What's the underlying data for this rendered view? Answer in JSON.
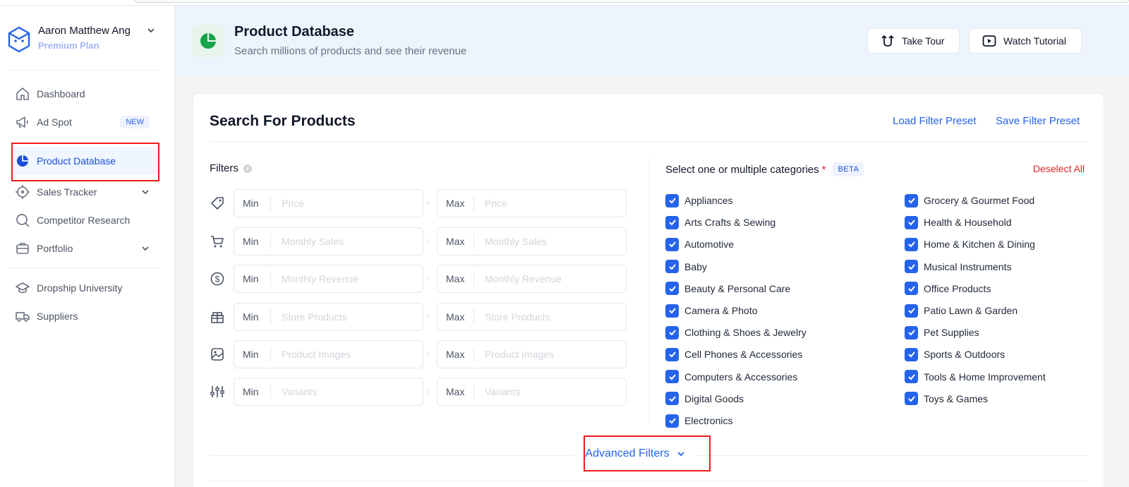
{
  "user": {
    "name": "Aaron Matthew Ang",
    "plan": "Premium Plan"
  },
  "sidebar": {
    "items": [
      {
        "label": "Dashboard",
        "icon": "home-icon"
      },
      {
        "label": "Ad Spot",
        "icon": "megaphone-icon",
        "badge": "NEW"
      },
      {
        "label": "Product Database",
        "icon": "pie-chart-icon",
        "active": true
      },
      {
        "label": "Sales Tracker",
        "icon": "crosshair-icon"
      },
      {
        "label": "Competitor Research",
        "icon": "search-icon"
      },
      {
        "label": "Portfolio",
        "icon": "briefcase-icon"
      },
      {
        "label": "Dropship University",
        "icon": "graduation-cap-icon"
      },
      {
        "label": "Suppliers",
        "icon": "truck-icon"
      }
    ]
  },
  "header": {
    "title": "Product Database",
    "subtitle": "Search millions of products and see their revenue",
    "take_tour": "Take Tour",
    "watch_tutorial": "Watch Tutorial"
  },
  "search": {
    "title": "Search For Products",
    "load_preset": "Load Filter Preset",
    "save_preset": "Save Filter Preset",
    "filters_label": "Filters",
    "min_label": "Min",
    "max_label": "Max",
    "filters": [
      {
        "placeholder": "Price",
        "icon": "tag-icon"
      },
      {
        "placeholder": "Monthly Sales",
        "icon": "cart-icon"
      },
      {
        "placeholder": "Monthly Revenue",
        "icon": "dollar-icon"
      },
      {
        "placeholder": "Store Products",
        "icon": "gift-icon"
      },
      {
        "placeholder": "Product Images",
        "icon": "image-icon"
      },
      {
        "placeholder": "Variants",
        "icon": "sliders-icon"
      }
    ],
    "categories_label": "Select one or multiple categories",
    "required_mark": "*",
    "beta": "BETA",
    "deselect_all": "Deselect All",
    "categories_left": [
      "Appliances",
      "Arts Crafts & Sewing",
      "Automotive",
      "Baby",
      "Beauty & Personal Care",
      "Camera & Photo",
      "Clothing & Shoes & Jewelry",
      "Cell Phones & Accessories",
      "Computers & Accessories",
      "Digital Goods",
      "Electronics"
    ],
    "categories_right": [
      "Grocery & Gourmet Food",
      "Health & Household",
      "Home & Kitchen & Dining",
      "Musical Instruments",
      "Office Products",
      "Patio Lawn & Garden",
      "Pet Supplies",
      "Sports & Outdoors",
      "Tools & Home Improvement",
      "Toys & Games"
    ],
    "advanced_filters": "Advanced Filters"
  },
  "colors": {
    "accent": "#2563eb",
    "highlight": "#ef1b1b",
    "danger": "#dc2626",
    "header_bg": "#eef4fd"
  }
}
